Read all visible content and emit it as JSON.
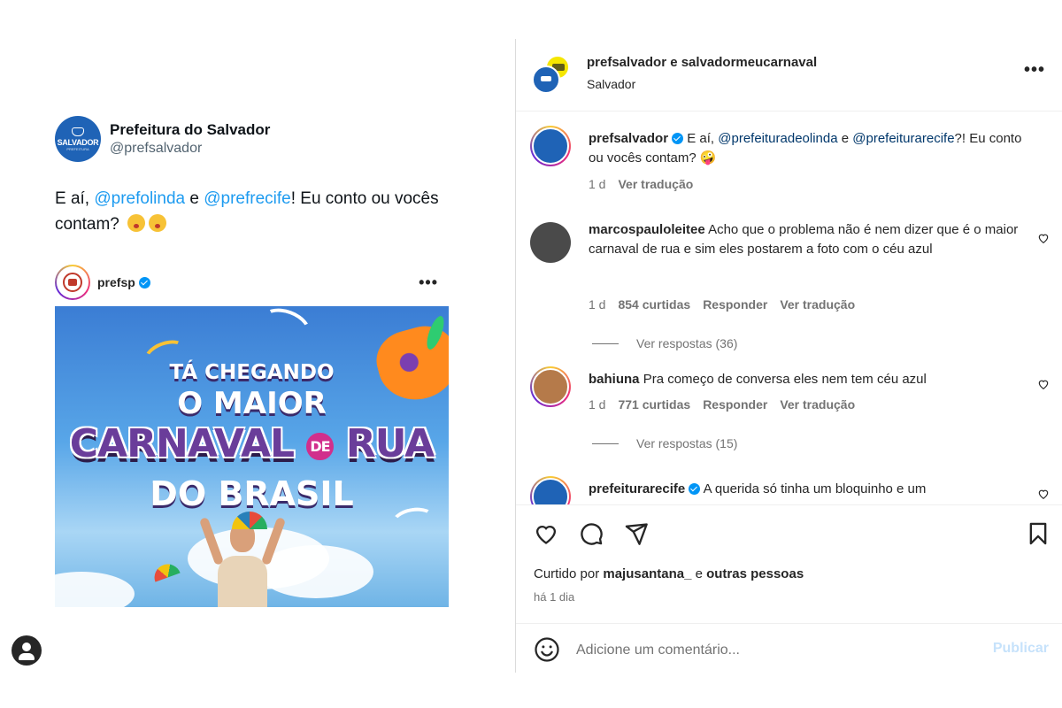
{
  "tweet": {
    "logo_word": "SALVADOR",
    "logo_sub": "PREFEITURA",
    "name": "Prefeitura do Salvador",
    "handle": "@prefsalvador",
    "text_1": "E aí, ",
    "mention_1": "@prefolinda",
    "text_2": " e ",
    "mention_2": "@prefrecife",
    "text_3": "! Eu conto ou vocês contam?"
  },
  "embed": {
    "user": "prefsp",
    "more": "•••",
    "poster": {
      "line1": "TÁ CHEGANDO",
      "line2": "O MAIOR",
      "line3a": "CARNAVAL",
      "line3_badge": "DE",
      "line3b": "RUA",
      "line4": "DO BRASIL"
    }
  },
  "post": {
    "header_title": "prefsalvador e salvadormeucarnaval",
    "location": "Salvador",
    "more": "•••",
    "comments": [
      {
        "user": "prefsalvador",
        "verified": true,
        "text_pre": "E aí, ",
        "mention_1": "@prefeituradeolinda",
        "text_mid": " e ",
        "mention_2": "@prefeiturarecife",
        "text_post": "?! Eu conto ou vocês contam? 🤪",
        "age": "1 d",
        "translate": "Ver tradução"
      },
      {
        "user": "marcospauloleitee",
        "text": "Acho que o problema não é nem dizer que é o maior carnaval de rua e sim eles postarem a foto com o céu azul",
        "age": "1 d",
        "likes": "854 curtidas",
        "reply": "Responder",
        "translate": "Ver tradução",
        "replies": "Ver respostas (36)"
      },
      {
        "user": "bahiuna",
        "text": "Pra começo de conversa eles nem tem céu azul",
        "age": "1 d",
        "likes": "771 curtidas",
        "reply": "Responder",
        "translate": "Ver tradução",
        "replies": "Ver respostas (15)"
      },
      {
        "user": "prefeiturarecife",
        "verified": true,
        "text": "A querida só tinha um bloquinho e um"
      }
    ],
    "liked_prefix": "Curtido por ",
    "liked_user": "majusantana_",
    "liked_mid": " e ",
    "liked_others": "outras pessoas",
    "time": "há 1 dia",
    "comment_placeholder": "Adicione um comentário...",
    "publish": "Publicar"
  },
  "colors": {
    "link": "#00376b",
    "mention_twitter": "#1d9bf0",
    "verified": "#0095f6",
    "publish_disabled": "#c6e2fb"
  }
}
